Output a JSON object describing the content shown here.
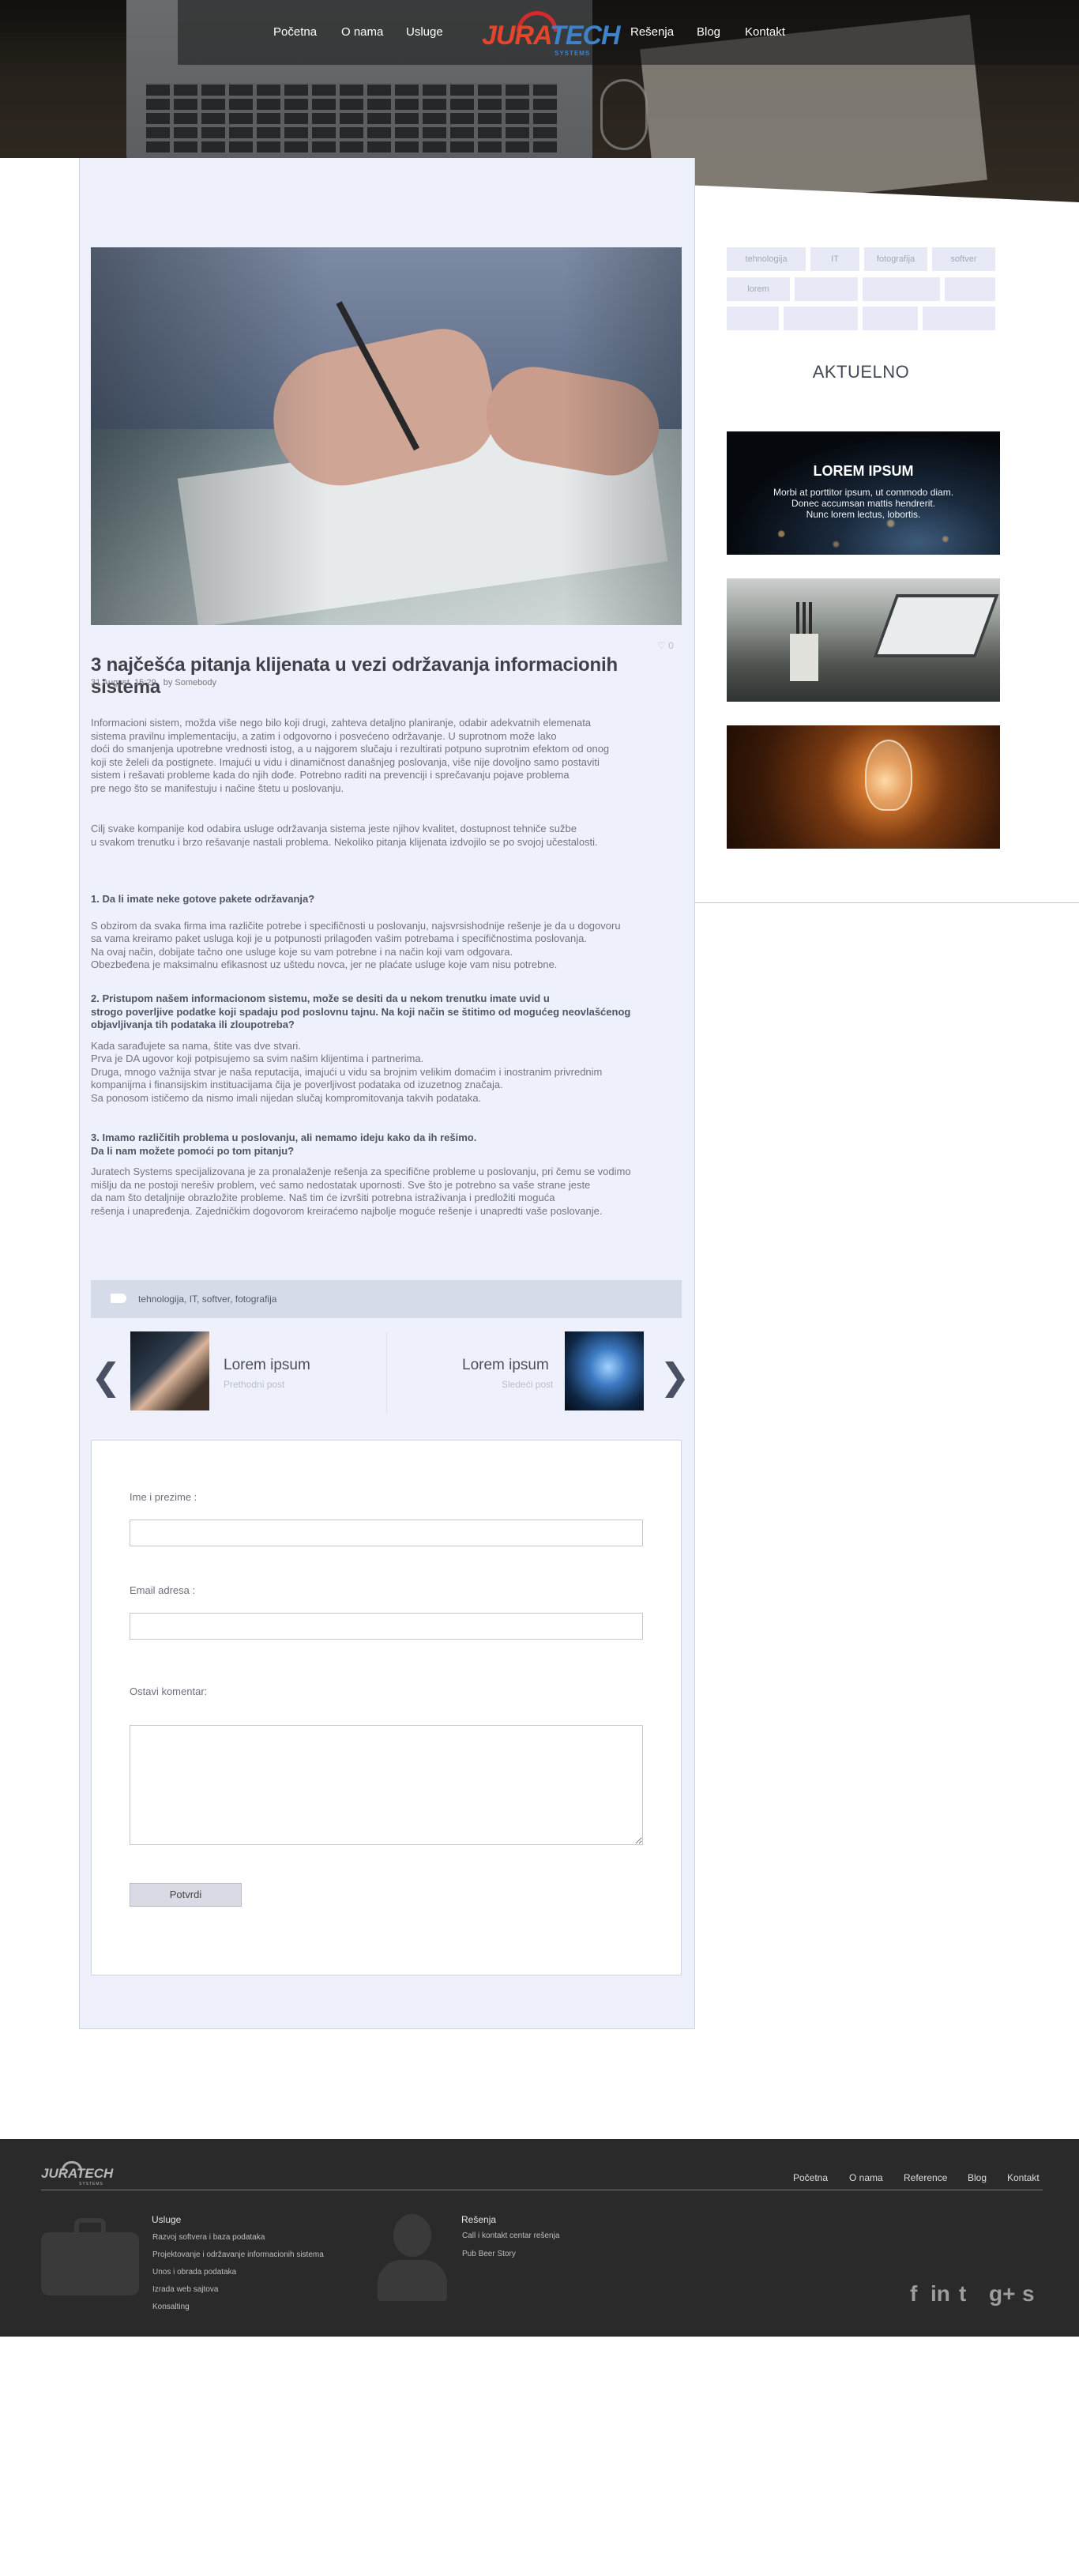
{
  "header": {
    "nav_left": [
      "Početna",
      "O nama",
      "Usluge"
    ],
    "nav_right": [
      "Rešenja",
      "Blog",
      "Kontakt"
    ],
    "logo": {
      "word_part1": "JURA",
      "word_part2": "TECH",
      "tagline": "SYSTEMS"
    }
  },
  "post": {
    "comments_count": "0",
    "title": "3 najčešća pitanja klijenata u vezi održavanja informacionih sistema",
    "date": "31 August, 15:29",
    "author": "by Somebody",
    "intro": [
      "Informacioni sistem, možda više nego bilo koji drugi, zahteva detaljno planiranje, odabir adekvatnih elemenata",
      "sistema pravilnu implementaciju, a zatim i odgovorno i posvećeno održavanje. U suprotnom može lako",
      "doći do smanjenja upotrebne vrednosti istog, a u najgorem slučaju i rezultirati potpuno suprotnim efektom od onog",
      " koji ste želeli da postignete. Imajući u vidu i dinamičnost današnjeg poslovanja, više nije dovoljno samo postaviti",
      "sistem i rešavati probleme kada do njih dođe. Potrebno raditi na prevenciji i sprečavanju pojave problema",
      "pre nego što se manifestuju i načine štetu u poslovanju."
    ],
    "intro2": [
      "Cilj svake kompanije kod odabira usluge održavanja sistema jeste njihov kvalitet, dostupnost tehniče sužbe",
      "u svakom trenutku i brzo rešavanje nastali problema. Nekoliko pitanja klijenata izdvojilo se po svojoj učestalosti."
    ],
    "q1": {
      "heading": "1. Da li imate neke gotove pakete održavanja?",
      "lines": [
        "S obzirom da svaka firma ima različite potrebe i specifičnosti u poslovanju, najsvrsishodnije rešenje je da u dogovoru",
        "sa vama kreiramo paket usluga koji je u potpunosti prilagođen vašim potrebama i specifičnostima poslovanja.",
        "Na ovaj način, dobijate tačno one usluge koje su vam potrebne i na način koji vam odgovara.",
        "Obezbeđena je maksimalnu efikasnost uz uštedu novca, jer ne plaćate usluge koje vam nisu potrebne."
      ]
    },
    "q2": {
      "heading": [
        "2. Pristupom našem informacionom sistemu, može se desiti da u nekom trenutku imate uvid u",
        "strogo poverljive podatke koji spadaju pod poslovnu tajnu. Na koji način se štitimo od mogućeg neovlašćenog",
        "objavljivanja tih podataka ili zloupotreba?"
      ],
      "lines": [
        "Kada sarađujete sa nama, štite vas dve stvari.",
        "Prva je DA ugovor koji potpisujemo sa svim našim klijentima i partnerima.",
        "Druga, mnogo važnija stvar je naša reputacija, imajući u vidu sa brojnim velikim domaćim i inostranim privrednim",
        " kompanijma i finansijskim instituacijama čija je poverljivost podataka od izuzetnog značaja.",
        "Sa ponosom ističemo da nismo imali nijedan slučaj kompromitovanja takvih podataka."
      ]
    },
    "q3": {
      "heading": [
        "3. Imamo različitih problema u poslovanju, ali nemamo ideju kako da ih rešimo.",
        "Da li nam možete pomoći po tom pitanju?"
      ],
      "lines": [
        "Juratech Systems specijalizovana je za pronalaženje rešenja za specifične probleme u poslovanju, pri čemu se vodimo",
        "mišlju da ne postoji nerešiv problem, već samo nedostatak upornosti. Sve što je potrebno sa vaše strane jeste",
        "da nam što detaljnije obrazložite probleme. Naš tim će izvršiti potrebna istraživanja i predložiti moguća",
        "rešenja i unapređenja. Zajedničkim dogovorom kreiraćemo najbolje moguće rešenje i unapredti vaše poslovanje."
      ]
    },
    "tags": "tehnologija,  IT,  softver,  fotografija"
  },
  "post_nav": {
    "prev_arrow": "❮",
    "next_arrow": "❯",
    "prev_title": "Lorem ipsum",
    "prev_sub": "Prethodni post",
    "next_title": "Lorem ipsum",
    "next_sub": "Sledeći post"
  },
  "comment_form": {
    "name_label": "Ime i prezime :",
    "email_label": "Email adresa :",
    "comment_label": "Ostavi komentar:",
    "submit_label": "Potvrdi"
  },
  "sidebar": {
    "tags": [
      "tehnologija",
      "IT",
      "fotografija",
      "softver",
      "lorem",
      "",
      "",
      "",
      "",
      "",
      "",
      ""
    ],
    "section_title": "AKTUELNO",
    "featured_card": {
      "title": "LOREM IPSUM",
      "lines": [
        "Morbi at porttitor ipsum, ut commodo diam.",
        "Donec accumsan mattis hendrerit.",
        "Nunc lorem lectus, lobortis."
      ]
    }
  },
  "footer": {
    "logo": {
      "word": "JURATECH",
      "tagline": "SYSTEMS"
    },
    "nav": [
      "Početna",
      "O nama",
      "Reference",
      "Blog",
      "Kontakt"
    ],
    "usluge_title": "Usluge",
    "usluge_links": [
      "Razvoj softvera i baza podataka",
      "Projektovanje i održavanje informacionih sistema",
      "Unos i obrada podataka",
      "Izrada web sajtova",
      "Konsalting"
    ],
    "resenja_title": "Rešenja",
    "resenja_links": [
      "Call i kontakt centar rešenja",
      "Pub Beer Story"
    ],
    "social": [
      "f",
      "in",
      "t",
      "g+",
      "s"
    ]
  }
}
